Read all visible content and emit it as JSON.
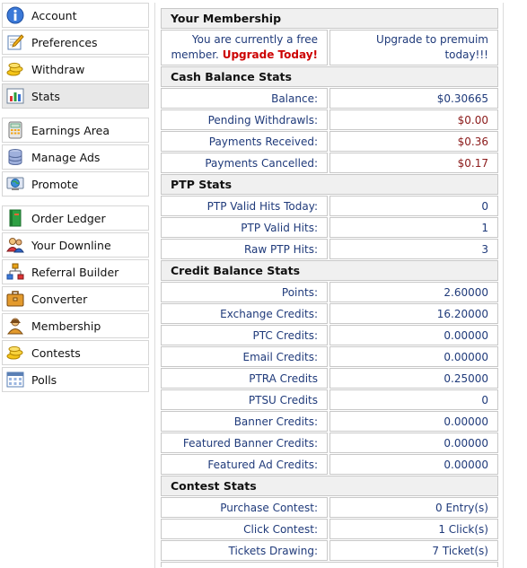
{
  "sidebar": {
    "groups": [
      [
        {
          "label": "Account",
          "icon": "info-icon"
        },
        {
          "label": "Preferences",
          "icon": "pencil-icon"
        },
        {
          "label": "Withdraw",
          "icon": "coins-icon"
        },
        {
          "label": "Stats",
          "icon": "bar-chart-icon",
          "active": true
        }
      ],
      [
        {
          "label": "Earnings Area",
          "icon": "calculator-icon"
        },
        {
          "label": "Manage Ads",
          "icon": "database-icon"
        },
        {
          "label": "Promote",
          "icon": "globe-icon"
        }
      ],
      [
        {
          "label": "Order Ledger",
          "icon": "ledger-icon"
        },
        {
          "label": "Your Downline",
          "icon": "users-icon"
        },
        {
          "label": "Referral Builder",
          "icon": "sitemap-icon"
        },
        {
          "label": "Converter",
          "icon": "briefcase-icon"
        },
        {
          "label": "Membership",
          "icon": "user-icon"
        },
        {
          "label": "Contests",
          "icon": "coins-icon"
        },
        {
          "label": "Polls",
          "icon": "calendar-icon"
        }
      ]
    ]
  },
  "membership": {
    "title": "Your Membership",
    "status_text": "You are currently a free member.",
    "upgrade_cta": "Upgrade Today!",
    "upgrade_link": "Upgrade to premuim today!!!"
  },
  "cash": {
    "title": "Cash Balance Stats",
    "rows": [
      {
        "label": "Balance:",
        "value": "$0.30665"
      },
      {
        "label": "Pending Withdrawls:",
        "value": "$0.00"
      },
      {
        "label": "Payments Received:",
        "value": "$0.36"
      },
      {
        "label": "Payments Cancelled:",
        "value": "$0.17"
      }
    ]
  },
  "ptp": {
    "title": "PTP Stats",
    "rows": [
      {
        "label": "PTP Valid Hits Today:",
        "value": "0"
      },
      {
        "label": "PTP Valid Hits:",
        "value": "1"
      },
      {
        "label": "Raw PTP Hits:",
        "value": "3"
      }
    ]
  },
  "credit": {
    "title": "Credit Balance Stats",
    "rows": [
      {
        "label": "Points:",
        "value": "2.60000"
      },
      {
        "label": "Exchange Credits:",
        "value": "16.20000"
      },
      {
        "label": "PTC Credits:",
        "value": "0.00000"
      },
      {
        "label": "Email Credits:",
        "value": "0.00000"
      },
      {
        "label": "PTRA Credits",
        "value": "0.25000"
      },
      {
        "label": "PTSU Credits",
        "value": "0"
      },
      {
        "label": "Banner Credits:",
        "value": "0.00000"
      },
      {
        "label": "Featured Banner Credits:",
        "value": "0.00000"
      },
      {
        "label": "Featured Ad Credits:",
        "value": "0.00000"
      }
    ]
  },
  "contest": {
    "title": "Contest Stats",
    "rows": [
      {
        "label": "Purchase Contest:",
        "value": "0 Entry(s)"
      },
      {
        "label": "Click Contest:",
        "value": "1 Click(s)"
      },
      {
        "label": "Tickets Drawing:",
        "value": "7 Ticket(s)"
      }
    ]
  },
  "colors": {
    "label_text": "#1f3a7a",
    "money_red": "#8b1a1a",
    "cta_red": "#cc0000"
  }
}
